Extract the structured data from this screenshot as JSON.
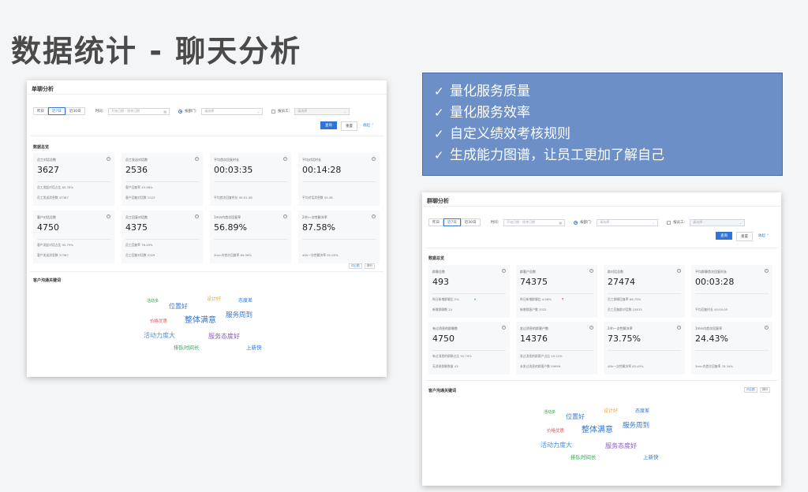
{
  "slide": {
    "title": "数据统计 - 聊天分析"
  },
  "bullets": [
    "量化服务质量",
    "量化服务效率",
    "自定义绩效考核规则",
    "生成能力图谱，让员工更加了解自己"
  ],
  "bullet_glyph": "✓",
  "panel1": {
    "title": "单聊分析",
    "tabs": [
      "昨日",
      "近7日",
      "近30日"
    ],
    "time_label": "时间：",
    "time_placeholder": "开始日期 - 结束日期",
    "dept_label": "按部门：",
    "dept_placeholder": "请选择",
    "staff_label": "按员工：",
    "staff_placeholder": "请选择",
    "query": "查询",
    "reset": "重置",
    "collapse": "收起 ⌃",
    "overview": "数据总览",
    "metrics": [
      {
        "title": "员工对话总数",
        "value": "3627",
        "l1": "员工发起对话占比  65.78%",
        "l2": "员工发送消息数  47387"
      },
      {
        "title": "员工发送对话数",
        "value": "2536",
        "l1": "客户回复率  45.56%",
        "l2": "客户回复对话数  1023"
      },
      {
        "title": "平均首次回复时长",
        "value": "00:03:35",
        "l1": "",
        "l2": "平均首次回复时长  00:01:48"
      },
      {
        "title": "平均对话时长",
        "value": "00:14:28",
        "l1": "",
        "l2": "平均对话消息数  45.38"
      },
      {
        "title": "客户对话总数",
        "value": "4750",
        "l1": "客户发起对话占比  92.79%",
        "l2": "客户发送消息数  37367"
      },
      {
        "title": "员工回复对话数",
        "value": "4375",
        "l1": "员工回复率  76.49%",
        "l2": "员工回复对话数  2029"
      },
      {
        "title": "1min内首次回复率",
        "value": "56.89%",
        "l1": "",
        "l2": "3min内首次回复率  69.56%"
      },
      {
        "title": "24h一次性解决率",
        "value": "87.58%",
        "l1": "",
        "l2": "48h一次性解决率  92.00%"
      }
    ],
    "buttons_small": [
      "词云图",
      "排行"
    ],
    "keywords_title": "客户沟通关键词",
    "words": [
      {
        "text": "活动多",
        "color": "#2a9d4b"
      },
      {
        "text": "位置好",
        "color": "#3a78d6"
      },
      {
        "text": "设计好",
        "color": "#e6a23c"
      },
      {
        "text": "态度差",
        "color": "#2f74d6"
      },
      {
        "text": "价格优惠",
        "color": "#e45757"
      },
      {
        "text": "整体满意",
        "color": "#2f74d6"
      },
      {
        "text": "服务周到",
        "color": "#3a78d6"
      },
      {
        "text": "活动力度大",
        "color": "#4a90e2"
      },
      {
        "text": "服务态度好",
        "color": "#8a5cc2"
      },
      {
        "text": "排队时间长",
        "color": "#2ea44f"
      },
      {
        "text": "上新快",
        "color": "#2f74d6"
      }
    ]
  },
  "panel2": {
    "title": "群聊分析",
    "tabs": [
      "昨日",
      "近7日",
      "近30日"
    ],
    "time_label": "时间：",
    "time_placeholder": "开始日期 - 结束日期",
    "dept_label": "按部门：",
    "dept_placeholder": "请选择",
    "staff_label": "按员工：",
    "staff_placeholder": "请选择",
    "query": "查询",
    "reset": "重置",
    "collapse": "收起 ⌃",
    "overview": "数据总览",
    "metrics": [
      {
        "title": "群聊总数",
        "value": "493",
        "l1": "昨日新增群聊比  5%",
        "l1t": "up",
        "l2": "新增群聊数  24"
      },
      {
        "title": "群客户总数",
        "value": "74375",
        "l1": "昨日新增群聊比  4.56%",
        "l1t": "down",
        "l2": "新增群客户数  3332"
      },
      {
        "title": "群对话总数",
        "value": "27474",
        "l1": "员工群聊回复率  66.75%",
        "l2": "员工回复群对话数  23833"
      },
      {
        "title": "平均群聊首次回复时长",
        "value": "00:03:28",
        "l1": "",
        "l2": "平均回复时长  00:05:05"
      },
      {
        "title": "有过消息的群聊数",
        "value": "4750",
        "l1": "有过消息的群聊占比  92.79%",
        "l2": "无消息群聊数量  43"
      },
      {
        "title": "发过消息的群客户数",
        "value": "14376",
        "l1": "发过消息的群客户占比  19.22%",
        "l2": "未发过消息的群客户数  59999"
      },
      {
        "title": "24h一次性解决率",
        "value": "73.75%",
        "l1": "",
        "l2": "48h一次性解决率  83.45%"
      },
      {
        "title": "1min内首次回复率",
        "value": "24.43%",
        "l1": "",
        "l2": "3min内首次回复率  78.34%"
      }
    ],
    "buttons_small": [
      "词云图",
      "排行"
    ],
    "keywords_title": "客户沟通关键词"
  }
}
